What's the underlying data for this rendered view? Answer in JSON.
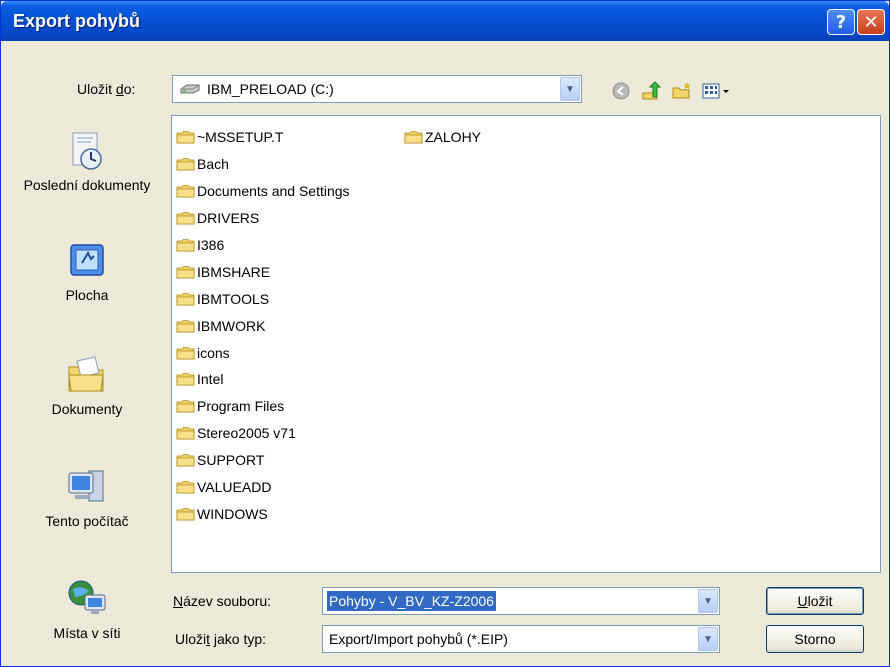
{
  "dialog": {
    "title": "Export pohybů"
  },
  "titlebar": {
    "help_glyph": "?",
    "close_glyph": "✕"
  },
  "save_in": {
    "label_prefix": "Uložit ",
    "label_accel": "d",
    "label_suffix": "o:",
    "value": "IBM_PRELOAD (C:)",
    "drive_icon": "hard-drive-icon"
  },
  "toolbar": {
    "back_icon": "back-arrow-icon",
    "up_icon": "up-folder-icon",
    "new_folder_icon": "new-folder-icon",
    "view_icon": "view-menu-icon"
  },
  "places": [
    {
      "name": "recent-documents",
      "label": "Poslední dokumenty",
      "icon": "recent-documents-icon"
    },
    {
      "name": "desktop",
      "label": "Plocha",
      "icon": "desktop-icon"
    },
    {
      "name": "documents",
      "label": "Dokumenty",
      "icon": "my-documents-icon"
    },
    {
      "name": "my-computer",
      "label": "Tento počítač",
      "icon": "my-computer-icon"
    },
    {
      "name": "network-places",
      "label": "Místa v síti",
      "icon": "network-places-icon"
    }
  ],
  "folders_col1": [
    "~MSSETUP.T",
    "Bach",
    "Documents and Settings",
    "DRIVERS",
    "I386",
    "IBMSHARE",
    "IBMTOOLS",
    "IBMWORK",
    "icons",
    "Intel",
    "Program Files",
    "Stereo2005 v71",
    "SUPPORT",
    "VALUEADD",
    "WINDOWS"
  ],
  "folders_col2": [
    "ZALOHY"
  ],
  "filename": {
    "label_accel": "N",
    "label_rest": "ázev souboru:",
    "value": "Pohyby - V_BV_KZ-Z2006"
  },
  "filetype": {
    "label_prefix": "Uloži",
    "label_accel": "t",
    "label_suffix": " jako typ:",
    "value": "Export/Import pohybů (*.EIP)"
  },
  "buttons": {
    "save_accel": "U",
    "save_rest": "ložit",
    "cancel": "Storno"
  },
  "colors": {
    "titlebar": "#0551d4",
    "dialog_bg": "#ece9d8",
    "selection": "#316ac5",
    "folder": "#f3d46b"
  }
}
